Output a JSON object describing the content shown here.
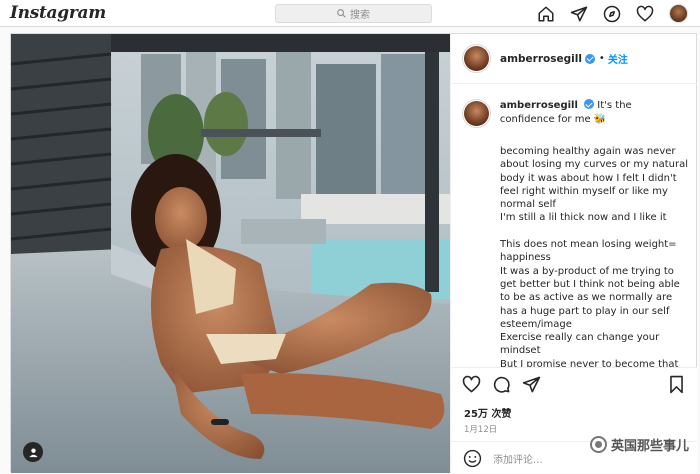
{
  "header": {
    "logo": "Instagram",
    "search_placeholder": "搜索"
  },
  "post": {
    "username": "amberrosegill",
    "follow_separator": "•",
    "follow_label": "关注",
    "caption_lead": "It's the confidence for me 🐝",
    "caption_body": "becoming healthy again was never about losing my curves or my natural body it was about how I felt I didn't feel right within myself or like my normal self\nI'm still a lil thick now and I like it\n\nThis does not mean losing weight= happiness\nIt was a by-product of me trying to get better but I think not being able to be as active as we normally are has a huge part to play in our self esteem/image\nExercise really can change your mindset\nBut I promise never to become that",
    "likes": "25万 次赞",
    "date": "1月12日",
    "comment_placeholder": "添加评论..."
  },
  "watermark": "英国那些事儿",
  "icons": {
    "home": "home-icon",
    "direct": "paper-plane-icon",
    "explore": "compass-icon",
    "activity": "heart-icon",
    "like": "heart-icon",
    "comment": "comment-icon",
    "share": "paper-plane-icon",
    "save": "bookmark-icon",
    "emoji": "smiley-icon",
    "tag": "user-tag-icon"
  }
}
